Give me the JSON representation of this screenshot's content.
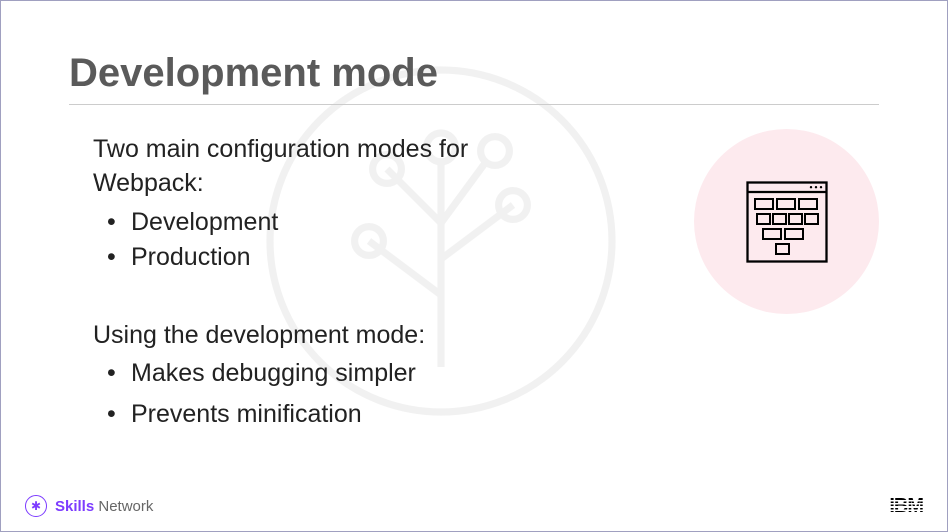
{
  "title": "Development mode",
  "section1": {
    "intro": "Two main configuration modes for Webpack:",
    "items": [
      "Development",
      "Production"
    ]
  },
  "section2": {
    "intro": "Using the development mode:",
    "items": [
      "Makes debugging simpler",
      "Prevents minification"
    ]
  },
  "footer": {
    "brand_bold": "Skills",
    "brand_rest": " Network",
    "right_logo": "IBM"
  },
  "icon": {
    "name": "browser-grid-icon"
  }
}
